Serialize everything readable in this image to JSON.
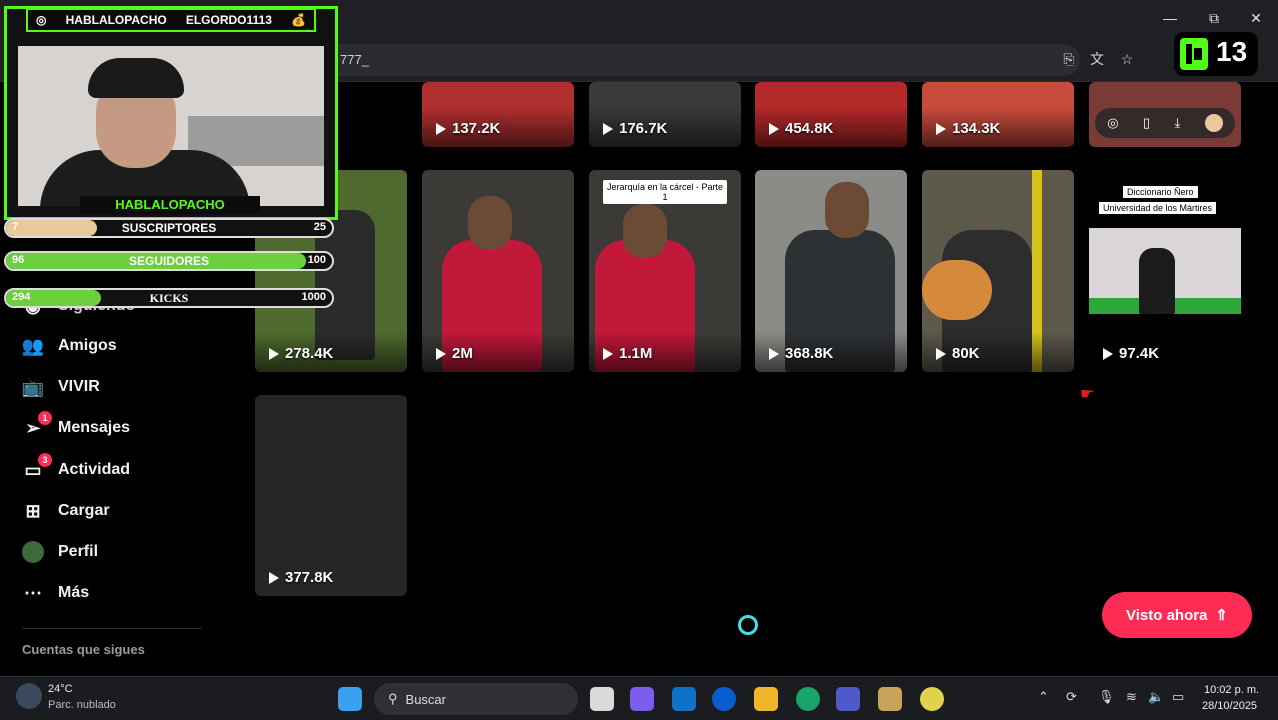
{
  "browser": {
    "url_text": "777_",
    "window_controls": {
      "minimize": "—",
      "maximize": "⧉",
      "close": "✕"
    }
  },
  "kick_badge": {
    "number": "13"
  },
  "overlay": {
    "top_handle_left": "HABLALOPACHO",
    "top_handle_right": "ELGORDO1113",
    "cam_name": "HABLALOPACHO",
    "bars": [
      {
        "label": "SUSCRIPTORES",
        "min": "7",
        "max": "25",
        "progress": 0.28,
        "color": "#e8c99a"
      },
      {
        "label": "SEGUIDORES",
        "min": "96",
        "max": "100",
        "progress": 0.96,
        "color": "#6ccf3e"
      },
      {
        "label": "KICKS",
        "min": "294",
        "max": "1000",
        "progress": 0.29,
        "color": "#6ccf3e"
      }
    ]
  },
  "sidebar": {
    "partial_item": "Siguiendo",
    "items": [
      {
        "label": "Amigos",
        "icon": "friends-icon"
      },
      {
        "label": "VIVIR",
        "icon": "live-tv-icon"
      },
      {
        "label": "Mensajes",
        "icon": "messages-icon",
        "badge": "1"
      },
      {
        "label": "Actividad",
        "icon": "activity-icon",
        "badge": "3"
      },
      {
        "label": "Cargar",
        "icon": "upload-icon"
      },
      {
        "label": "Perfil",
        "icon": "avatar"
      },
      {
        "label": "Más",
        "icon": "more-icon"
      }
    ],
    "following_accounts_label": "Cuentas que sigues"
  },
  "videos": {
    "row1": [
      "137.2K",
      "176.7K",
      "454.8K",
      "134.3K",
      ""
    ],
    "row2": [
      "278.4K",
      "2M",
      "1.1M",
      "368.8K",
      "80K",
      "97.4K"
    ],
    "row3": [
      "377.8K"
    ],
    "captions": {
      "tile_r2c3": "Jerarquía en la cárcel - Parte 1",
      "tile_r2c6_line1": "Diccionario Ñero",
      "tile_r2c6_line2": "Universidad de los Mártires"
    }
  },
  "watched_button": {
    "label": "Visto ahora"
  },
  "taskbar": {
    "weather_temp": "24°C",
    "weather_desc": "Parc. nublado",
    "search_label": "Buscar",
    "time": "10:02 p. m.",
    "date": "28/10/2025"
  }
}
